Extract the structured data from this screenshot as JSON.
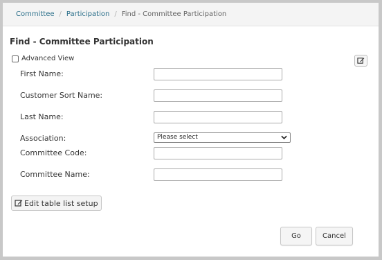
{
  "breadcrumb": {
    "items": [
      "Committee",
      "Participation"
    ],
    "current": "Find - Committee Participation"
  },
  "page": {
    "title": "Find - Committee Participation"
  },
  "advanced_view": {
    "label": "Advanced View",
    "checked": false
  },
  "form": {
    "first_name_label": "First Name:",
    "customer_sort_name_label": "Customer Sort Name:",
    "last_name_label": "Last Name:",
    "association_label": "Association:",
    "association_selected": "Please select",
    "committee_code_label": "Committee Code:",
    "committee_name_label": "Committee Name:"
  },
  "edit_table_label": "Edit table list setup",
  "actions": {
    "go": "Go",
    "cancel": "Cancel"
  },
  "icons": {
    "edit": "edit-icon",
    "dropdown": "chevron-down-icon"
  }
}
